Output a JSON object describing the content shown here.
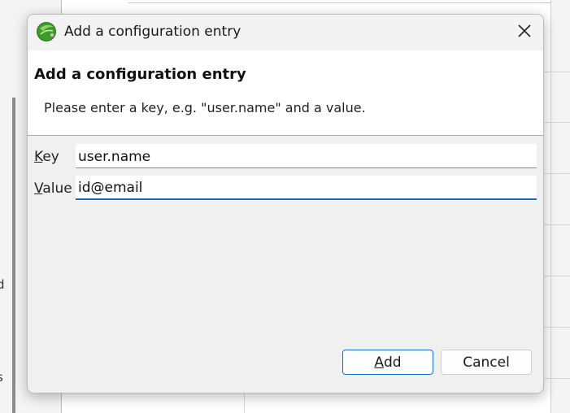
{
  "background": {
    "fragment_text_1": "d",
    "fragment_text_2": "s"
  },
  "dialog": {
    "window_title": "Add a configuration entry",
    "header_title": "Add a configuration entry",
    "header_message": "Please enter a key, e.g. \"user.name\" and a value.",
    "fields": [
      {
        "label_mnemonic": "K",
        "label_rest": "ey",
        "value": "user.name"
      },
      {
        "label_mnemonic": "V",
        "label_rest": "alue",
        "value": "id@email"
      }
    ],
    "buttons": {
      "add_mnemonic": "A",
      "add_rest": "dd",
      "cancel": "Cancel"
    }
  },
  "colors": {
    "focus_accent": "#1a6cc7",
    "app_icon_green": "#3c9a2b"
  },
  "icons": {
    "app": "eclipse-logo-icon",
    "close": "close-icon"
  }
}
